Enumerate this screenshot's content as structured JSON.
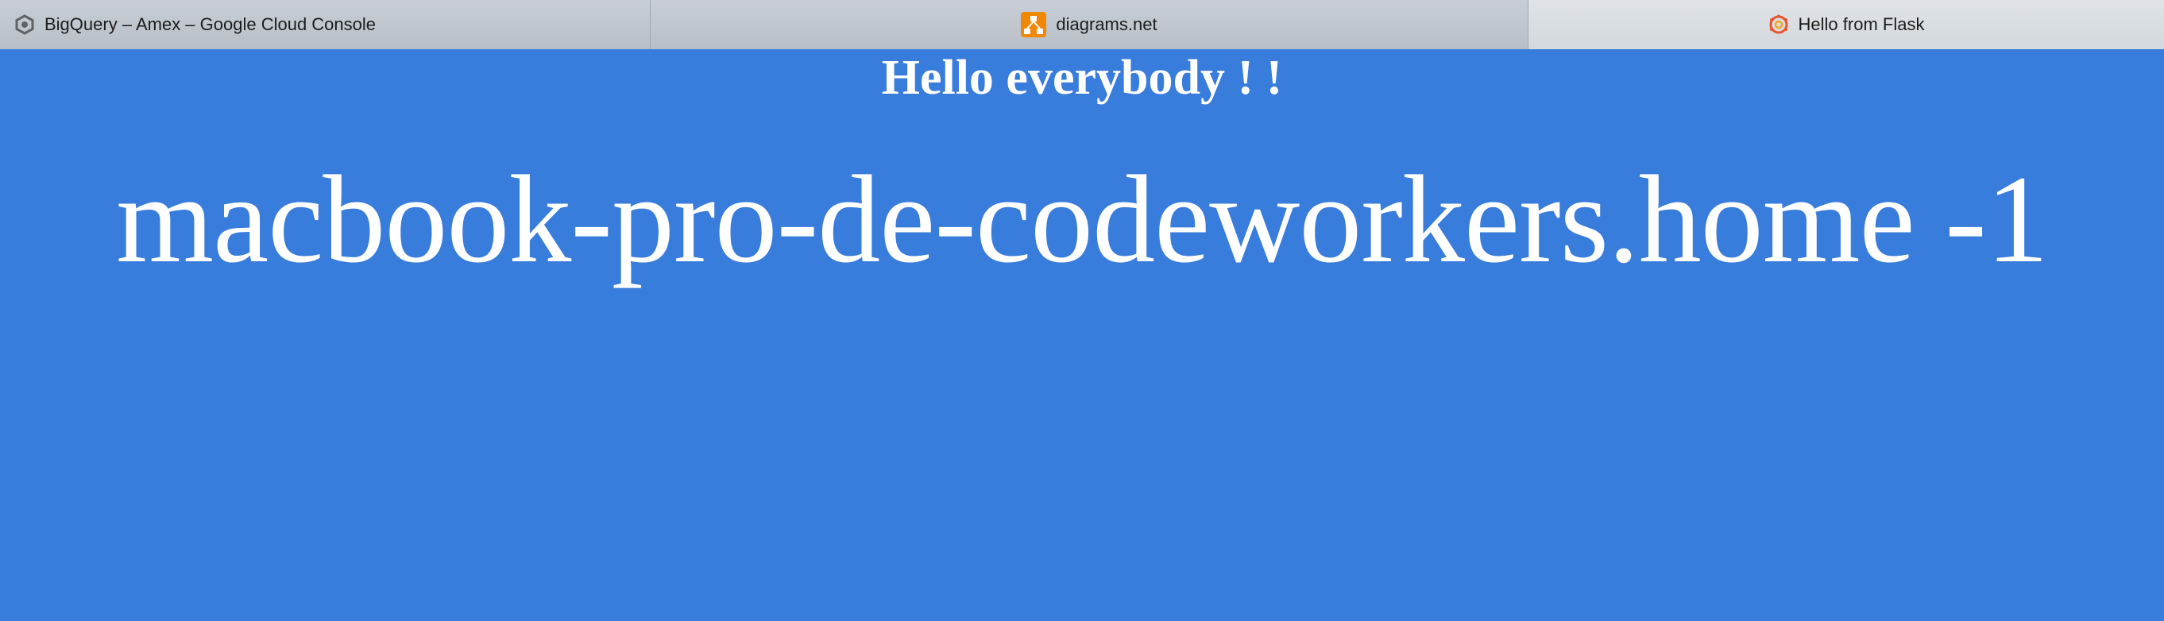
{
  "browser": {
    "tabs": [
      {
        "title": "BigQuery – Amex – Google Cloud Console",
        "icon": "google-cloud-hexagon-icon",
        "active": false
      },
      {
        "title": "diagrams.net",
        "icon": "diagrams-net-icon",
        "active": false
      },
      {
        "title": "Hello from Flask",
        "icon": "grafana-swirl-icon",
        "active": true
      }
    ]
  },
  "page": {
    "greeting": "Hello everybody ! !",
    "hostname_line": "macbook-pro-de-codeworkers.home -1"
  },
  "colors": {
    "background": "#387cdc",
    "text": "#ffffff",
    "diagrams_icon": "#f08705",
    "grafana_icon": "#e8552d"
  }
}
